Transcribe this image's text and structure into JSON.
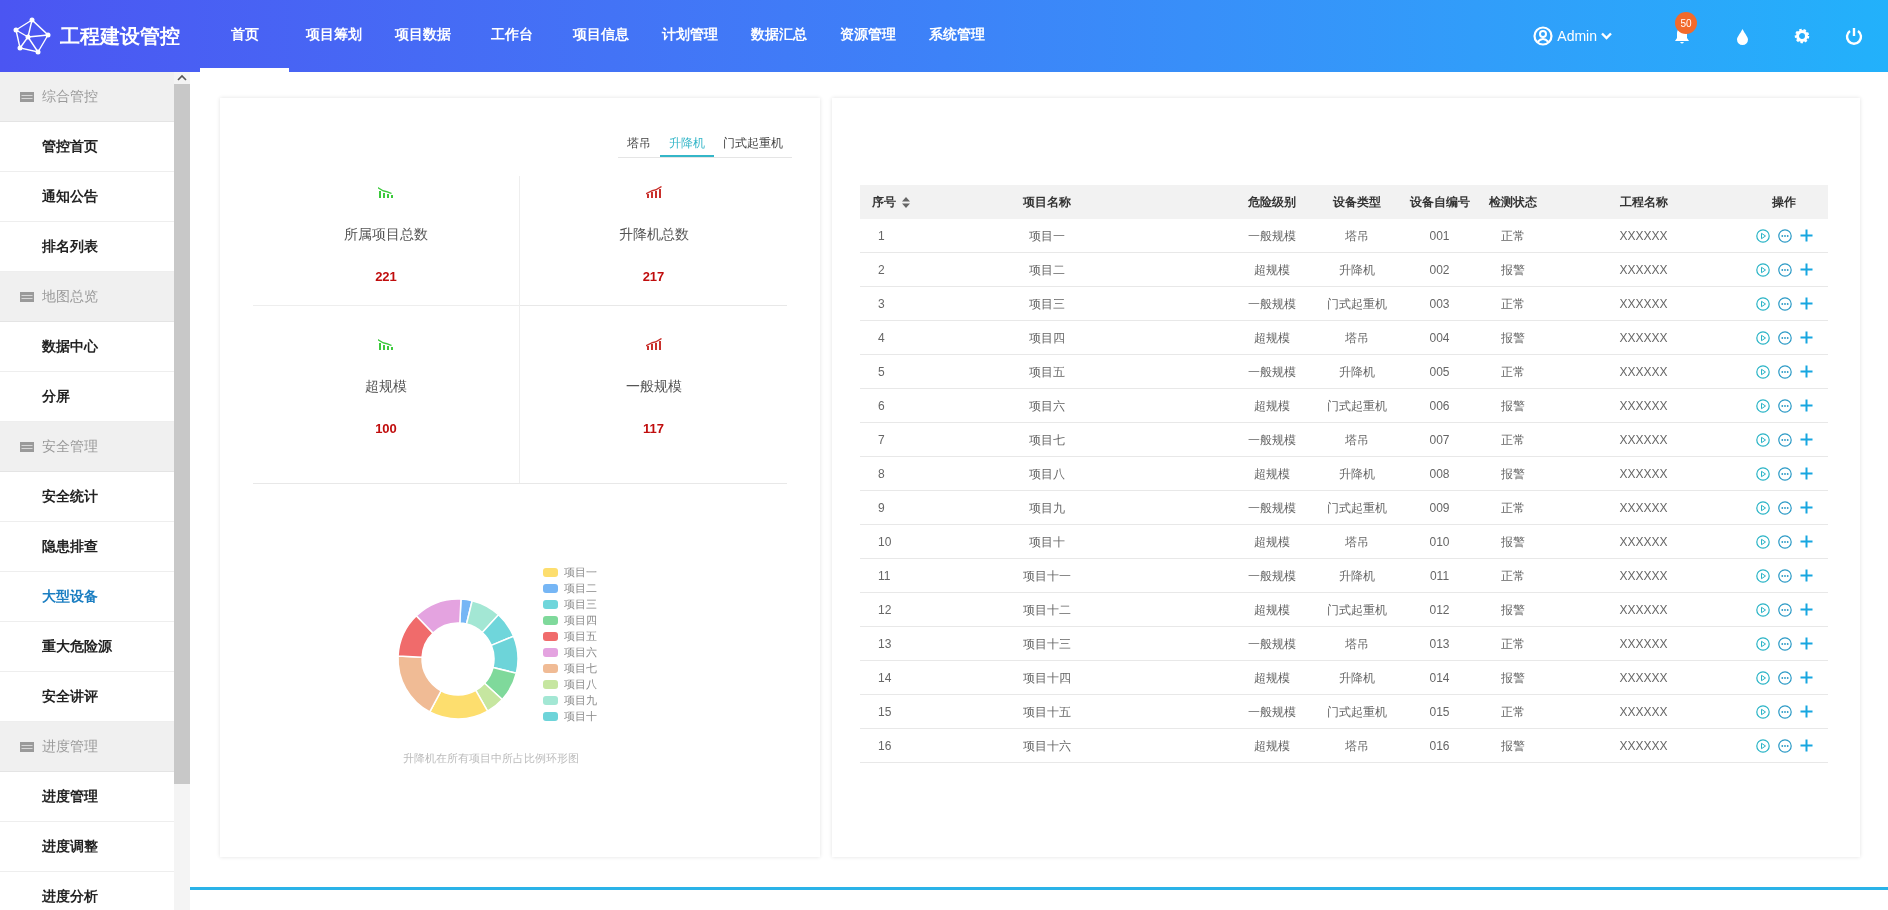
{
  "header": {
    "logo": "工程建设管控",
    "nav": [
      {
        "label": "首页",
        "selected": true
      },
      {
        "label": "项目筹划",
        "selected": false
      },
      {
        "label": "项目数据",
        "selected": false
      },
      {
        "label": "工作台",
        "selected": false
      },
      {
        "label": "项目信息",
        "selected": false
      },
      {
        "label": "计划管理",
        "selected": false
      },
      {
        "label": "数据汇总",
        "selected": false
      },
      {
        "label": "资源管理",
        "selected": false
      },
      {
        "label": "系统管理",
        "selected": false
      }
    ],
    "user": "Admin",
    "notification_count": "50"
  },
  "sidebar": {
    "groups": [
      {
        "title": "综合管控",
        "items": [
          {
            "label": "管控首页",
            "selected": false
          },
          {
            "label": "通知公告",
            "selected": false
          },
          {
            "label": "排名列表",
            "selected": false
          }
        ]
      },
      {
        "title": "地图总览",
        "items": [
          {
            "label": "数据中心",
            "selected": false
          },
          {
            "label": "分屏",
            "selected": false
          }
        ]
      },
      {
        "title": "安全管理",
        "items": [
          {
            "label": "安全统计",
            "selected": false
          },
          {
            "label": "隐患排查",
            "selected": false
          },
          {
            "label": "大型设备",
            "selected": true
          },
          {
            "label": "重大危险源",
            "selected": false
          },
          {
            "label": "安全讲评",
            "selected": false
          }
        ]
      },
      {
        "title": "进度管理",
        "items": [
          {
            "label": "进度管理",
            "selected": false
          },
          {
            "label": "进度调整",
            "selected": false
          },
          {
            "label": "进度分析",
            "selected": false
          }
        ]
      }
    ]
  },
  "stats_panel": {
    "tabs": [
      {
        "label": "塔吊",
        "selected": false
      },
      {
        "label": "升降机",
        "selected": true
      },
      {
        "label": "门式起重机",
        "selected": false
      }
    ],
    "stats": [
      {
        "label": "所属项目总数",
        "value": "221",
        "kind": "down"
      },
      {
        "label": "升降机总数",
        "value": "217",
        "kind": "up"
      },
      {
        "label": "超规模",
        "value": "100",
        "kind": "down"
      },
      {
        "label": "一般规模",
        "value": "117",
        "kind": "up"
      }
    ],
    "legend": [
      {
        "label": "项目一",
        "color": "#fdde6e"
      },
      {
        "label": "项目二",
        "color": "#76b6f5"
      },
      {
        "label": "项目三",
        "color": "#6fd6db"
      },
      {
        "label": "项目四",
        "color": "#7fd99b"
      },
      {
        "label": "项目五",
        "color": "#f06b6b"
      },
      {
        "label": "项目六",
        "color": "#e4a3e0"
      },
      {
        "label": "项目七",
        "color": "#f0bb95"
      },
      {
        "label": "项目八",
        "color": "#c6e6a0"
      },
      {
        "label": "项目九",
        "color": "#a3e7d4"
      },
      {
        "label": "项目十",
        "color": "#6dd4d9"
      }
    ],
    "chart_caption": "升降机在所有项目中所占比例环形图"
  },
  "table": {
    "columns": [
      "序号",
      "项目名称",
      "危险级别",
      "设备类型",
      "设备自编号",
      "检测状态",
      "工程名称",
      "操作"
    ],
    "rows": [
      [
        "1",
        "项目一",
        "一般规模",
        "塔吊",
        "001",
        "正常",
        "XXXXXX"
      ],
      [
        "2",
        "项目二",
        "超规模",
        "升降机",
        "002",
        "报警",
        "XXXXXX"
      ],
      [
        "3",
        "项目三",
        "一般规模",
        "门式起重机",
        "003",
        "正常",
        "XXXXXX"
      ],
      [
        "4",
        "项目四",
        "超规模",
        "塔吊",
        "004",
        "报警",
        "XXXXXX"
      ],
      [
        "5",
        "项目五",
        "一般规模",
        "升降机",
        "005",
        "正常",
        "XXXXXX"
      ],
      [
        "6",
        "项目六",
        "超规模",
        "门式起重机",
        "006",
        "报警",
        "XXXXXX"
      ],
      [
        "7",
        "项目七",
        "一般规模",
        "塔吊",
        "007",
        "正常",
        "XXXXXX"
      ],
      [
        "8",
        "项目八",
        "超规模",
        "升降机",
        "008",
        "报警",
        "XXXXXX"
      ],
      [
        "9",
        "项目九",
        "一般规模",
        "门式起重机",
        "009",
        "正常",
        "XXXXXX"
      ],
      [
        "10",
        "项目十",
        "超规模",
        "塔吊",
        "010",
        "报警",
        "XXXXXX"
      ],
      [
        "11",
        "项目十一",
        "一般规模",
        "升降机",
        "011",
        "正常",
        "XXXXXX"
      ],
      [
        "12",
        "项目十二",
        "超规模",
        "门式起重机",
        "012",
        "报警",
        "XXXXXX"
      ],
      [
        "13",
        "项目十三",
        "一般规模",
        "塔吊",
        "013",
        "正常",
        "XXXXXX"
      ],
      [
        "14",
        "项目十四",
        "超规模",
        "升降机",
        "014",
        "报警",
        "XXXXXX"
      ],
      [
        "15",
        "项目十五",
        "一般规模",
        "门式起重机",
        "015",
        "正常",
        "XXXXXX"
      ],
      [
        "16",
        "项目十六",
        "超规模",
        "塔吊",
        "016",
        "报警",
        "XXXXXX"
      ]
    ]
  }
}
